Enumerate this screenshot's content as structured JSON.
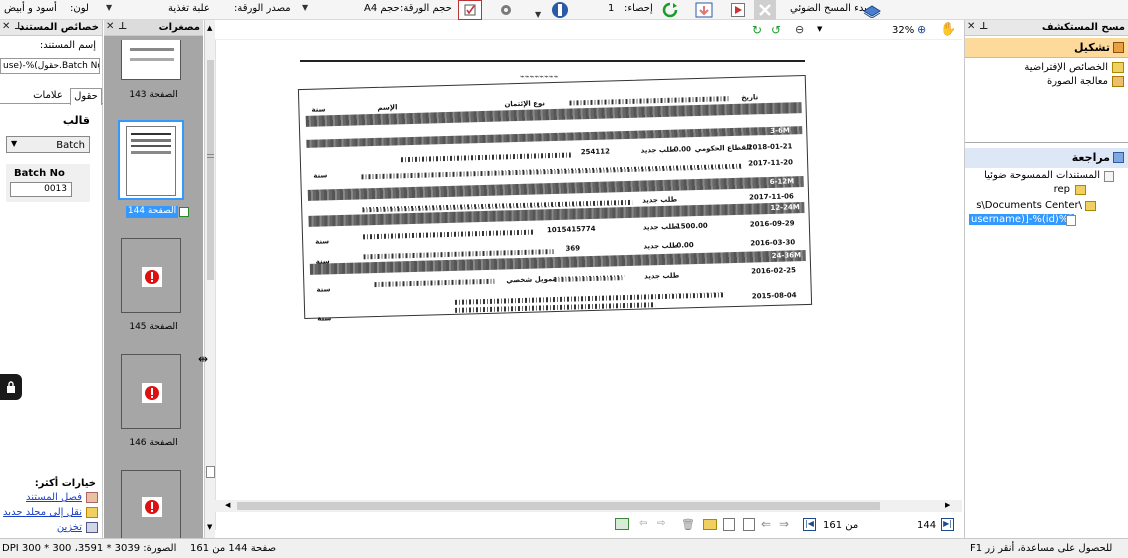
{
  "toolbar": {
    "color_label": "لون:",
    "color_value": "أسود و أبيض",
    "source_label": "مصدر الورقة:",
    "source_value": "علبة تغذية",
    "size_label": "حجم الورقة:",
    "size_value": "حجم A4",
    "stats_label": "إحصاء:",
    "stats_value": "1",
    "start_scan_label": "بدء المسح الضوئي"
  },
  "left_panel": {
    "title": "خصائص المستند",
    "doc_name_label": "إسم المستند:",
    "doc_name_value": "use)-%(حقول.Batch No)",
    "tab_fields": "حقول",
    "tab_bookmarks": "علامات",
    "template_label": "قالب",
    "template_value": "Batch",
    "field_label": "Batch No",
    "field_value": "0013",
    "more_options": "خيارات أكثر:",
    "link_split": "فصل المستند",
    "link_move": "نقل إلى مجلد جديد",
    "link_save": "تخزين"
  },
  "thumbs": {
    "title": "مصغرات",
    "pages": [
      {
        "label": "الصفحة 143"
      },
      {
        "label": "الصفحة 144"
      },
      {
        "label": "الصفحة 145"
      },
      {
        "label": "الصفحة 146"
      }
    ]
  },
  "viewer": {
    "zoom": "32%",
    "page_current": "144",
    "page_of": "من 161",
    "doc": {
      "date_header": "تاريخ",
      "name_header": "الإسم",
      "type_header": "نوع الإئتمان",
      "groups": [
        "3-6M",
        "6-12M",
        "12-24M",
        "24-36M"
      ],
      "rows": [
        {
          "date": "2018-01-21",
          "amount": "0.00",
          "type": "القطاع الحكومي",
          "ref": "254112",
          "status": "طلب جديد"
        },
        {
          "date": "2017-11-20",
          "amount": "",
          "type": "",
          "ref": "",
          "status": ""
        },
        {
          "date": "2017-11-06",
          "amount": "",
          "type": "",
          "ref": "",
          "status": "طلب جديد"
        },
        {
          "date": "2016-09-29",
          "amount": "1500.00",
          "type": "",
          "ref": "1015415774",
          "status": "طلب جديد"
        },
        {
          "date": "2016-03-30",
          "amount": "0.00",
          "type": "",
          "ref": "369",
          "status": "طلب جديد"
        },
        {
          "date": "2016-02-25",
          "amount": "",
          "type": "تمويل شخصي",
          "ref": "",
          "status": "طلب جديد"
        },
        {
          "date": "2015-08-04",
          "amount": "",
          "type": "",
          "ref": "",
          "status": ""
        }
      ],
      "year_label": "سنة"
    }
  },
  "right_panel": {
    "title": "مسح المستكشف",
    "config_header": "تشكيل",
    "config_items": [
      "الخصائص الإفتراضية",
      "معالجة الصورة"
    ],
    "review_header": "مراجعة",
    "review_items": [
      "المستندات الممسوحة ضوئيا",
      "rep",
      "s\\Documents Center\\",
      "username)]-%(id)%]"
    ]
  },
  "statusbar": {
    "help": "للحصول على مساعدة، أنقر زر F1",
    "page_info": "صفحة 144 من 161",
    "image_info": "الصورة: 3039 * 3591، 300 * 300 DPI"
  },
  "colors": {
    "accent_orange": "#fdd99b",
    "selection_blue": "#3399ff",
    "panel_gray": "#a6a6a6"
  }
}
